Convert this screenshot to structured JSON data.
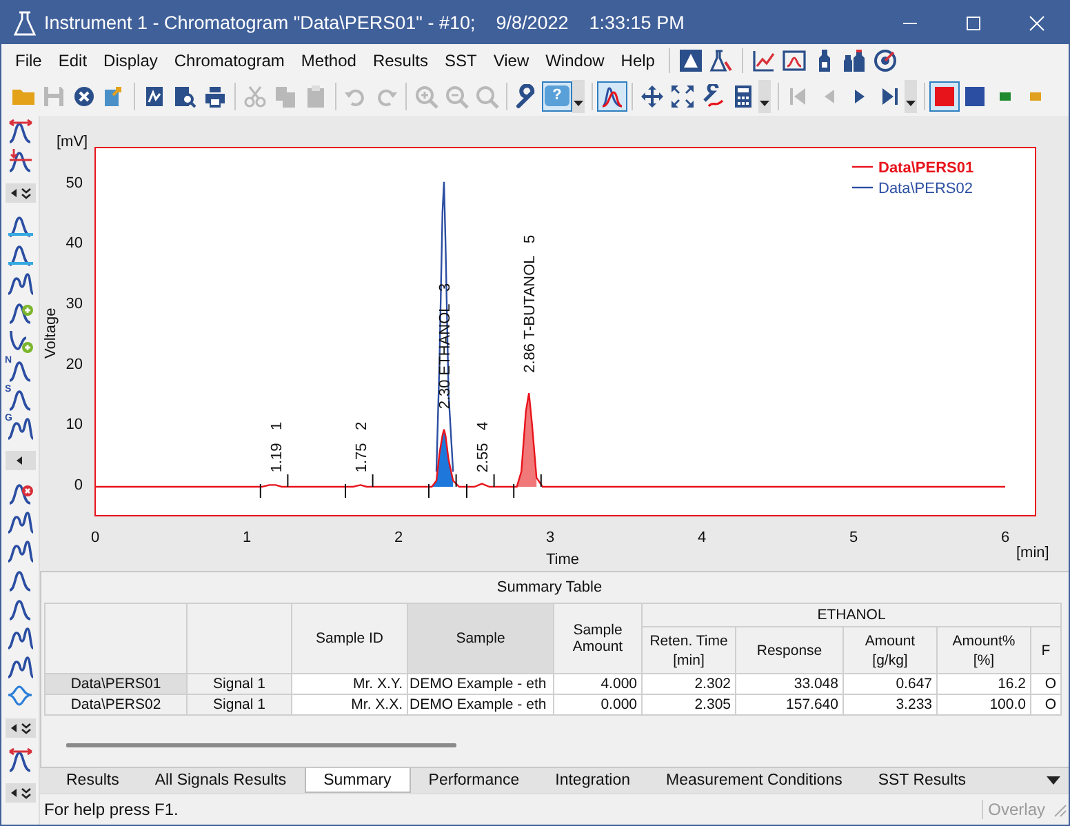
{
  "window": {
    "title": "Instrument 1 - Chromatogram \"Data\\PERS01\" - #10;    9/8/2022    1:33:15 PM"
  },
  "menu": [
    {
      "label": "File"
    },
    {
      "label": "Edit"
    },
    {
      "label": "Display"
    },
    {
      "label": "Chromatogram"
    },
    {
      "label": "Method"
    },
    {
      "label": "Results"
    },
    {
      "label": "SST"
    },
    {
      "label": "View"
    },
    {
      "label": "Window"
    },
    {
      "label": "Help"
    }
  ],
  "menu_icon_groups": [
    [
      {
        "kind": "triangle-badge"
      },
      {
        "kind": "flask"
      }
    ],
    [
      {
        "kind": "line-chart"
      },
      {
        "kind": "chart-window"
      },
      {
        "kind": "bottle"
      },
      {
        "kind": "bottles"
      },
      {
        "kind": "target"
      }
    ]
  ],
  "toolbar": [
    {
      "kind": "folder",
      "disabled": false,
      "selected": false
    },
    {
      "kind": "floppy",
      "disabled": true,
      "selected": false
    },
    {
      "kind": "close",
      "disabled": false,
      "selected": false
    },
    {
      "kind": "document-arrow",
      "disabled": false,
      "selected": false
    },
    {
      "kind": "separator"
    },
    {
      "kind": "chart-document",
      "disabled": false,
      "selected": false
    },
    {
      "kind": "document-search",
      "disabled": false,
      "selected": false
    },
    {
      "kind": "print",
      "disabled": false,
      "selected": false
    },
    {
      "kind": "separator"
    },
    {
      "kind": "scissors",
      "disabled": true,
      "selected": false
    },
    {
      "kind": "copy",
      "disabled": true,
      "selected": false
    },
    {
      "kind": "paste",
      "disabled": true,
      "selected": false
    },
    {
      "kind": "separator"
    },
    {
      "kind": "undo",
      "disabled": true,
      "selected": false
    },
    {
      "kind": "redo",
      "disabled": true,
      "selected": false
    },
    {
      "kind": "separator"
    },
    {
      "kind": "zoom-in",
      "disabled": true,
      "selected": false
    },
    {
      "kind": "zoom-out",
      "disabled": true,
      "selected": false
    },
    {
      "kind": "magnifier",
      "disabled": true,
      "selected": false
    },
    {
      "kind": "separator"
    },
    {
      "kind": "wrench",
      "disabled": false,
      "selected": false
    },
    {
      "kind": "help",
      "glyph": "?",
      "disabled": false,
      "selected": true,
      "has_menu": true
    },
    {
      "kind": "separator"
    },
    {
      "kind": "peaks-chart",
      "disabled": false,
      "selected": true
    },
    {
      "kind": "separator"
    },
    {
      "kind": "move",
      "disabled": false,
      "selected": false
    },
    {
      "kind": "expand",
      "disabled": false,
      "selected": false
    },
    {
      "kind": "wrench-curve",
      "disabled": false,
      "selected": false
    },
    {
      "kind": "calculator",
      "disabled": false,
      "selected": false,
      "has_menu": true
    },
    {
      "kind": "separator"
    },
    {
      "kind": "first",
      "disabled": true,
      "selected": false
    },
    {
      "kind": "previous",
      "disabled": true,
      "selected": false
    },
    {
      "kind": "play",
      "disabled": false,
      "selected": false
    },
    {
      "kind": "last",
      "disabled": false,
      "selected": false,
      "has_menu": true
    },
    {
      "kind": "separator"
    },
    {
      "kind": "square",
      "color": "#e8141c",
      "disabled": false,
      "selected": true
    },
    {
      "kind": "square",
      "color": "#2b4ea2",
      "disabled": false,
      "selected": false
    },
    {
      "kind": "small-square",
      "color": "#1f8a2e",
      "disabled": false,
      "selected": false
    },
    {
      "kind": "small-square",
      "color": "#e0a020",
      "disabled": false,
      "selected": false
    }
  ],
  "side_toolbar": [
    {
      "kind": "peak-arrows"
    },
    {
      "kind": "peak-arrows-down"
    },
    {
      "kind": "collapse"
    },
    {
      "kind": "peak-baseline"
    },
    {
      "kind": "peak-baseline"
    },
    {
      "kind": "double-peak"
    },
    {
      "kind": "peak-add"
    },
    {
      "kind": "valley-add"
    },
    {
      "kind": "peak",
      "letter": "N"
    },
    {
      "kind": "peak",
      "letter": "S"
    },
    {
      "kind": "double-peak",
      "letter": "G"
    },
    {
      "kind": "collapse-left"
    },
    {
      "kind": "peak-remove"
    },
    {
      "kind": "double-peak"
    },
    {
      "kind": "double-peak"
    },
    {
      "kind": "peak"
    },
    {
      "kind": "peak"
    },
    {
      "kind": "double-peak"
    },
    {
      "kind": "double-peak"
    },
    {
      "kind": "inverted-peak"
    },
    {
      "kind": "collapse"
    },
    {
      "kind": "peak-arrows"
    },
    {
      "kind": "collapse"
    }
  ],
  "chart": {
    "y_unit": "[mV]",
    "x_unit": "[min]",
    "chart_data": {
      "type": "line",
      "xlabel": "Time",
      "ylabel": "Voltage",
      "legend": "upper right",
      "x": [
        0,
        1.1,
        1.15,
        1.19,
        1.23,
        1.7,
        1.75,
        1.79,
        2.22,
        2.25,
        2.27,
        2.29,
        2.3,
        2.31,
        2.33,
        2.36,
        2.4,
        2.5,
        2.55,
        2.6,
        2.78,
        2.81,
        2.84,
        2.86,
        2.88,
        2.91,
        2.95,
        6.0
      ],
      "series": [
        {
          "name": "Data\\PERS01",
          "color": "#e8141c",
          "values": [
            -0.5,
            -0.5,
            -0.2,
            -0.2,
            -0.5,
            -0.5,
            -0.2,
            -0.5,
            -0.5,
            0.5,
            5,
            8,
            9,
            8,
            4,
            0.5,
            -0.5,
            -0.5,
            0,
            -0.5,
            -0.5,
            2,
            12,
            15,
            10,
            1,
            -0.5,
            -0.5
          ]
        },
        {
          "name": "Data\\PERS02",
          "color": "#2b4ea2",
          "values": [
            null,
            null,
            null,
            null,
            null,
            null,
            null,
            null,
            null,
            2,
            20,
            45,
            50,
            40,
            15,
            2,
            null,
            null,
            null,
            null,
            null,
            null,
            null,
            null,
            null,
            null,
            null,
            null
          ]
        }
      ],
      "xlim": [
        0,
        6.2
      ],
      "ylim": [
        -5.3,
        55.7
      ],
      "xticks": [
        0,
        1,
        2,
        3,
        4,
        5,
        6
      ],
      "yticks": [
        0,
        10,
        20,
        30,
        40,
        50
      ],
      "annotations": [
        "1.19   1",
        "1.75   2",
        "2.30 ETHANOL   3",
        "2.55   4",
        "2.86 T-BUTANOL   5"
      ]
    }
  },
  "summary_table": {
    "title": "Summary Table",
    "columns": [
      {
        "selected": false
      },
      {
        "selected": false
      },
      {
        "label": "Sample ID",
        "selected": false
      },
      {
        "label": "Sample",
        "selected": true
      },
      {
        "label": "Sample Amount",
        "selected": false
      }
    ],
    "group": {
      "label": "ETHANOL",
      "columns": [
        {
          "label": "Reten. Time",
          "unit": "[min]"
        },
        {
          "label": "Response"
        },
        {
          "label": "Amount",
          "unit": "[g/kg]"
        },
        {
          "label": "Amount%",
          "unit": "[%]"
        },
        {
          "label": "F"
        }
      ]
    },
    "rows": [
      {
        "selected": true,
        "cells": [
          "Data\\PERS01",
          "Signal 1",
          "Mr. X.Y.",
          "DEMO Example - eth",
          "4.000",
          "2.302",
          "33.048",
          "0.647",
          "16.2",
          "O"
        ]
      },
      {
        "selected": false,
        "cells": [
          "Data\\PERS02",
          "Signal 1",
          "Mr. X.X.",
          "DEMO Example - eth",
          "0.000",
          "2.305",
          "157.640",
          "3.233",
          "100.0",
          "O"
        ]
      }
    ]
  },
  "tabs": [
    {
      "label": "Results",
      "selected": false
    },
    {
      "label": "All Signals Results",
      "selected": false
    },
    {
      "label": "Summary",
      "selected": true
    },
    {
      "label": "Performance",
      "selected": false
    },
    {
      "label": "Integration",
      "selected": false
    },
    {
      "label": "Measurement Conditions",
      "selected": false
    },
    {
      "label": "SST Results",
      "selected": false
    }
  ],
  "status_bar": {
    "text": "For help press F1.",
    "indicators": [
      {
        "label": "Overlay",
        "disabled": true
      }
    ]
  }
}
